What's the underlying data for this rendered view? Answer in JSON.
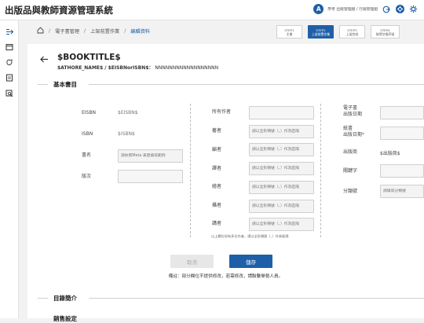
{
  "header": {
    "app_title": "出版品與教師資源管理系統",
    "avatar_letter": "A",
    "user_text": "學考 出版管理組 / 行銷管理組"
  },
  "breadcrumb": {
    "items": [
      "電子書管理",
      "上架前置作業",
      "編輯資料"
    ]
  },
  "steps": [
    {
      "line1": "STEP1",
      "line2": "主書"
    },
    {
      "line1": "STEP2",
      "line2": "上架前置作業"
    },
    {
      "line1": "STEP3",
      "line2": "上架完成"
    },
    {
      "line1": "STEP4",
      "line2": "取得兌換序號"
    }
  ],
  "book": {
    "title": "$BOOKTITLE$",
    "subtitle_label": "$ATHORE_NAME$ / $EISBNorISBN$：",
    "subtitle_value": "NNNNNNNNNNNNNNNNNN"
  },
  "sections": {
    "basic": "基本書目",
    "toc": "目錄簡介",
    "pricing": "銷售設定"
  },
  "col1": {
    "eisbn_label": "EISBN",
    "eisbn_value": "$EISBN$",
    "isbn_label": "ISBN",
    "isbn_value": "$ISBN$",
    "bookname_label": "書名",
    "bookname_placeholder": "請依照Meta 表匯填寫範例",
    "edition_label": "版次"
  },
  "col2": {
    "all_authors_label": "所有作者",
    "author_label": "著者",
    "editor_label": "編者",
    "translator_label": "譯者",
    "illustrator_label": "繪者",
    "compiler_label": "攝者",
    "narrator_label": "講者",
    "field_placeholder": "請以全形頓號（、）作為區隔",
    "hint": "以上欄位如有多位作者，請以全形頓號（、）作為區隔"
  },
  "col3": {
    "ebook_date_label_1": "電子書",
    "ebook_date_label_2": "出版日期",
    "paper_date_label_1": "紙書",
    "paper_date_label_2": "出版日期",
    "publisher_label": "出版商",
    "publisher_value": "$出版商$",
    "keyword_label": "關鍵字",
    "category_label": "分類號",
    "category_placeholder": "請填寫分類號"
  },
  "actions": {
    "cancel_label": "取消",
    "save_label": "儲存",
    "remark": "備註：部分欄位不提供修改，若需修改，請聯繫舉藝人員。"
  }
}
